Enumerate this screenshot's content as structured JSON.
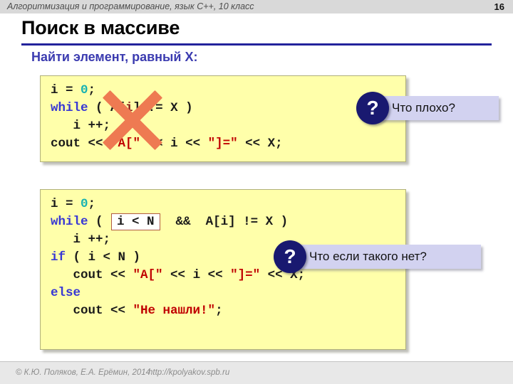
{
  "header": {
    "course_title": "Алгоритмизация и программирование, язык C++, 10 класс",
    "page_number": "16"
  },
  "slide": {
    "title": "Поиск в массиве",
    "subtitle": "Найти элемент, равный X:"
  },
  "code_block_1": {
    "line1_a": "i",
    "line1_b": " = ",
    "line1_num": "0",
    "line1_c": ";",
    "line2_kw": "while",
    "line2_a": " ( ",
    "line2_arr": "A[",
    "line2_idx": "i",
    "line2_arr2": "]",
    "line2_b": " != X )",
    "line3": "   i ++;",
    "line4_a": "cout ",
    "line4_op1": "<<",
    "line4_s1": " \"A[\" ",
    "line4_op2": "<<",
    "line4_i": " i ",
    "line4_op3": "<<",
    "line4_s2": " \"]=\" ",
    "line4_op4": "<<",
    "line4_x": " X;"
  },
  "code_block_2": {
    "line1_a": "i",
    "line1_b": " = ",
    "line1_num": "0",
    "line1_c": ";",
    "line2_kw": "while",
    "line2_open": " ( ",
    "line2_cond": "i < N",
    "line2_mid": "  &&  ",
    "line2_arr": "A[",
    "line2_idx": "i",
    "line2_arr2": "]",
    "line2_end": " != X )",
    "line3": "   i ++;",
    "line4_kw": "if",
    "line4_rest": " ( i < N )",
    "line5_a": "   cout ",
    "line5_op1": "<<",
    "line5_s1": " \"A[\" ",
    "line5_op2": "<<",
    "line5_i": " i ",
    "line5_op3": "<<",
    "line5_s2": " \"]=\" ",
    "line5_op4": "<<",
    "line5_x": " X;",
    "line6_kw": "else",
    "line7_a": "   cout ",
    "line7_op1": "<<",
    "line7_s1": " \"Не нашли!\"",
    "line7_b": ";"
  },
  "callouts": {
    "one": {
      "badge": "?",
      "label": "Что плохо?"
    },
    "two": {
      "badge": "?",
      "label": "Что если такого нет?"
    }
  },
  "annotations": {
    "cross_out": "red-x-over-while-loop"
  },
  "footer": {
    "copyright": "© К.Ю. Поляков, Е.А. Ерёмин, 2014",
    "url": "http://kpolyakov.spb.ru"
  },
  "colors": {
    "header_bar": "#d9d9d9",
    "title_rule": "#23239c",
    "subtitle": "#3b3bb0",
    "code_bg": "#ffffaa",
    "keyword": "#3737d4",
    "number": "#18b2b2",
    "string": "#c00000",
    "x_mark": "#ee7a52",
    "callout_bg": "#d2d2f0",
    "badge_bg": "#191970"
  }
}
